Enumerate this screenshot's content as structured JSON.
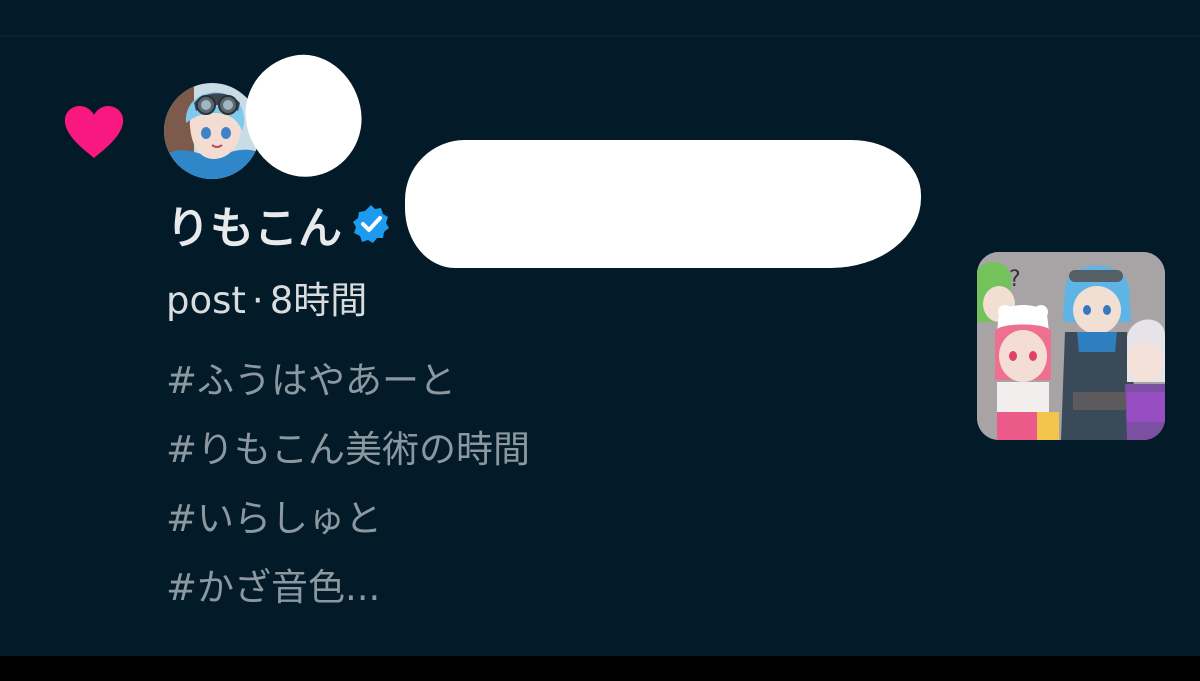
{
  "notification": {
    "type_icon": "heart-icon",
    "type_color": "#f91880",
    "user": {
      "display_name": "りもこん",
      "verified_icon": "verified-badge-icon",
      "verified_color": "#1d9bf0"
    },
    "meta": {
      "kind": "post",
      "separator": "·",
      "time": "8時間"
    },
    "hashtags": [
      "#ふうはやあーと",
      "#りもこん美術の時間",
      "#いらしゅと",
      "#かざ音色..."
    ],
    "thumbnail_icon": "post-image-thumbnail"
  },
  "colors": {
    "background": "#031a29",
    "primary_text": "#e7e9ea",
    "secondary_text": "#8b98a0"
  }
}
